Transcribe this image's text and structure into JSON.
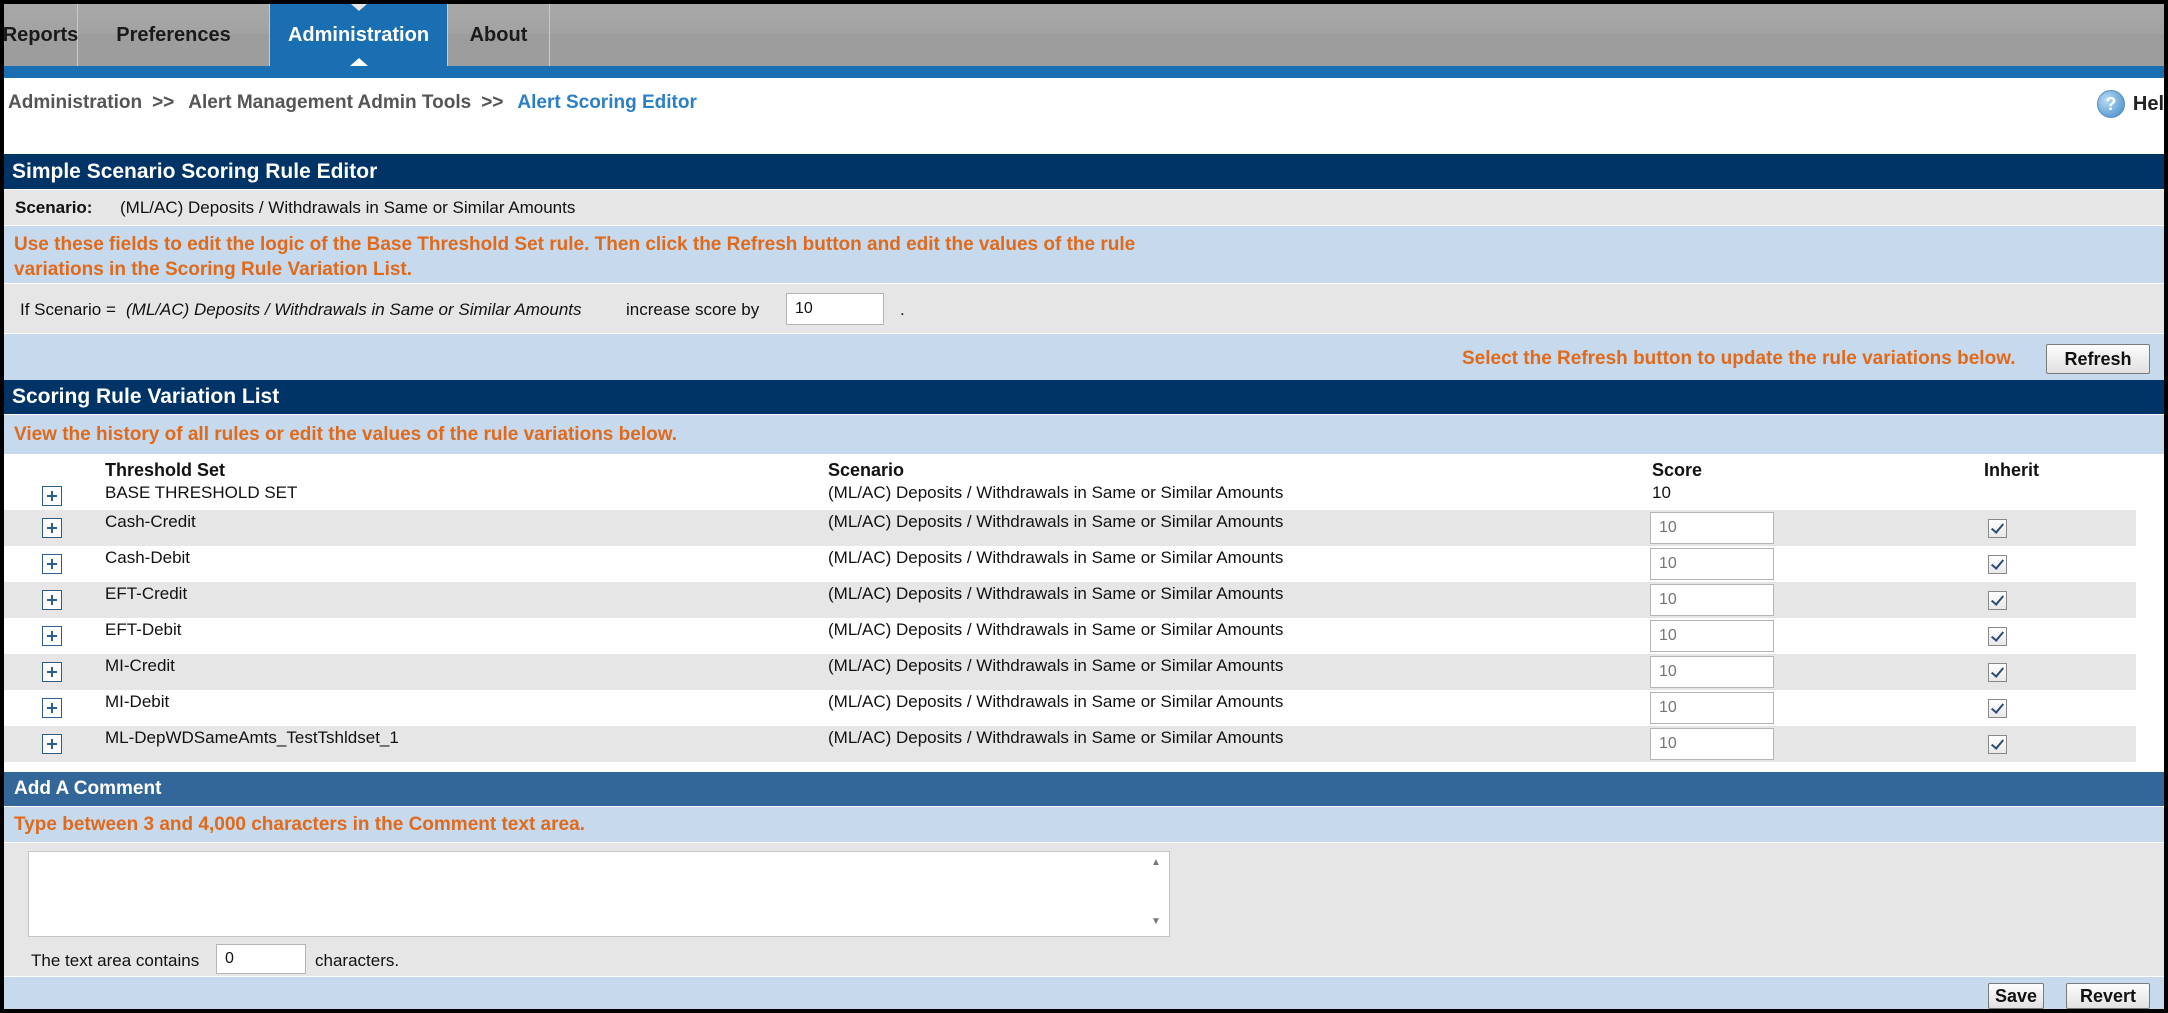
{
  "nav": {
    "tabs": [
      {
        "label": "Reports"
      },
      {
        "label": "Preferences"
      },
      {
        "label": "Administration"
      },
      {
        "label": "About"
      }
    ]
  },
  "breadcrumb": {
    "items": [
      "Administration",
      "Alert Management Admin Tools"
    ],
    "separator": ">>",
    "current": "Alert Scoring Editor"
  },
  "help": {
    "label": "Hel",
    "icon": "help-icon"
  },
  "editor": {
    "title": "Simple Scenario Scoring Rule Editor",
    "scenario_label": "Scenario:",
    "scenario_value": "(ML/AC) Deposits / Withdrawals in Same or Similar Amounts",
    "instruction_line1": "Use these fields to edit the logic of the Base Threshold Set rule. Then click the Refresh button and edit the values of the rule",
    "instruction_line2": "variations in the Scoring Rule Variation List.",
    "rule_prefix": "If Scenario =",
    "rule_scenario": "(ML/AC) Deposits / Withdrawals in Same or Similar Amounts",
    "rule_middle": "increase score by",
    "rule_score": "10",
    "rule_suffix": ".",
    "refresh_hint": "Select the Refresh button to update the rule variations below.",
    "refresh_label": "Refresh"
  },
  "variations": {
    "title": "Scoring Rule Variation List",
    "instruction": "View the history of all rules or edit the values of the rule variations below.",
    "columns": {
      "threshold_set": "Threshold Set",
      "scenario": "Scenario",
      "score": "Score",
      "inherit": "Inherit"
    },
    "rows": [
      {
        "threshold_set": "BASE THRESHOLD SET",
        "scenario": "(ML/AC) Deposits / Withdrawals in Same or Similar Amounts",
        "score": "10",
        "editable": false
      },
      {
        "threshold_set": "Cash-Credit",
        "scenario": "(ML/AC) Deposits / Withdrawals in Same or Similar Amounts",
        "score": "10",
        "editable": true,
        "inherit": true
      },
      {
        "threshold_set": "Cash-Debit",
        "scenario": "(ML/AC) Deposits / Withdrawals in Same or Similar Amounts",
        "score": "10",
        "editable": true,
        "inherit": true
      },
      {
        "threshold_set": "EFT-Credit",
        "scenario": "(ML/AC) Deposits / Withdrawals in Same or Similar Amounts",
        "score": "10",
        "editable": true,
        "inherit": true
      },
      {
        "threshold_set": "EFT-Debit",
        "scenario": "(ML/AC) Deposits / Withdrawals in Same or Similar Amounts",
        "score": "10",
        "editable": true,
        "inherit": true
      },
      {
        "threshold_set": "MI-Credit",
        "scenario": "(ML/AC) Deposits / Withdrawals in Same or Similar Amounts",
        "score": "10",
        "editable": true,
        "inherit": true
      },
      {
        "threshold_set": "MI-Debit",
        "scenario": "(ML/AC) Deposits / Withdrawals in Same or Similar Amounts",
        "score": "10",
        "editable": true,
        "inherit": true
      },
      {
        "threshold_set": "ML-DepWDSameAmts_TestTshldset_1",
        "scenario": "(ML/AC) Deposits / Withdrawals in Same or Similar Amounts",
        "score": "10",
        "editable": true,
        "inherit": true
      }
    ]
  },
  "comment": {
    "title": "Add A Comment",
    "instruction": "Type between 3 and 4,000 characters in the Comment text area.",
    "count_prefix": "The text area contains",
    "count_value": "0",
    "count_suffix": "characters.",
    "save_label": "Save",
    "revert_label": "Revert"
  },
  "colors": {
    "nav_active": "#1a6fb2",
    "section_dark": "#003366",
    "section_mid": "#336699",
    "hint_orange": "#e06a1b",
    "band_light": "#c7d9ec"
  }
}
